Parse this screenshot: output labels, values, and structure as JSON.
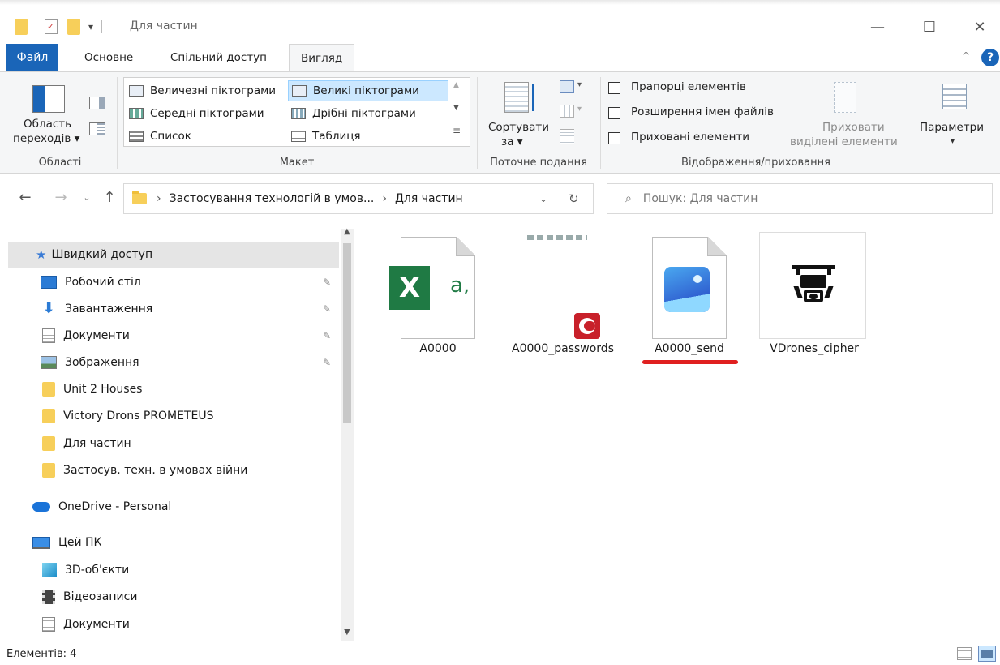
{
  "window": {
    "title": "Для частин",
    "minimize": "—",
    "maximize": "☐",
    "close": "✕"
  },
  "ribbon_tabs": [
    "Файл",
    "Основне",
    "Спільний доступ",
    "Вигляд"
  ],
  "ribbon": {
    "panes": {
      "nav_pane_line1": "Область",
      "nav_pane_line2": "переходів",
      "group": "Області"
    },
    "layout": {
      "items": [
        "Величезні піктограми",
        "Великі піктограми",
        "Середні піктограми",
        "Дрібні піктограми",
        "Список",
        "Таблиця"
      ],
      "group": "Макет"
    },
    "current_view": {
      "sort_line1": "Сортувати",
      "sort_line2": "за",
      "group": "Поточне подання"
    },
    "show_hide": {
      "item_checkboxes": "Прапорці елементів",
      "file_extensions": "Розширення імен файлів",
      "hidden_items": "Приховані елементи",
      "hide_selected_line1": "Приховати",
      "hide_selected_line2": "виділені елементи",
      "group": "Відображення/приховання"
    },
    "options": "Параметри"
  },
  "address": {
    "crumbs": [
      "Застосування технологій в умов...",
      "Для частин"
    ],
    "search_placeholder": "Пошук: Для частин"
  },
  "nav_pane": {
    "quick_access": "Швидкий доступ",
    "items": [
      {
        "label": "Робочий стіл",
        "icon": "desktop-icon",
        "pinned": true
      },
      {
        "label": "Завантаження",
        "icon": "download-icon",
        "pinned": true
      },
      {
        "label": "Документи",
        "icon": "documents-icon",
        "pinned": true
      },
      {
        "label": "Зображення",
        "icon": "pictures-icon",
        "pinned": true
      },
      {
        "label": "Unit 2 Houses",
        "icon": "folder-icon",
        "pinned": false
      },
      {
        "label": "Victory Drons PROMETEUS",
        "icon": "folder-icon",
        "pinned": false
      },
      {
        "label": "Для частин",
        "icon": "folder-icon",
        "pinned": false
      },
      {
        "label": "Застосув. техн. в умовах війни",
        "icon": "folder-icon",
        "pinned": false
      }
    ],
    "onedrive": "OneDrive - Personal",
    "this_pc": "Цей ПК",
    "pc_items": [
      {
        "label": "3D-об'єкти",
        "icon": "3d-objects-icon"
      },
      {
        "label": "Відеозаписи",
        "icon": "videos-icon"
      },
      {
        "label": "Документи",
        "icon": "documents-icon"
      }
    ]
  },
  "files": [
    {
      "name": "A0000",
      "type": "excel",
      "icon_text_main": "X",
      "icon_text_suffix": "a,"
    },
    {
      "name": "A0000_passwords",
      "type": "encrypted"
    },
    {
      "name": "A0000_send",
      "type": "image"
    },
    {
      "name": "VDrones_cipher",
      "type": "drone-image"
    }
  ],
  "status": {
    "items_count": "Елементів: 4"
  },
  "colors": {
    "file_tab": "#1a65b8",
    "selection": "#cce8ff",
    "underline": "#e02020",
    "excel": "#1f7a44",
    "folder": "#f7cf5a"
  }
}
